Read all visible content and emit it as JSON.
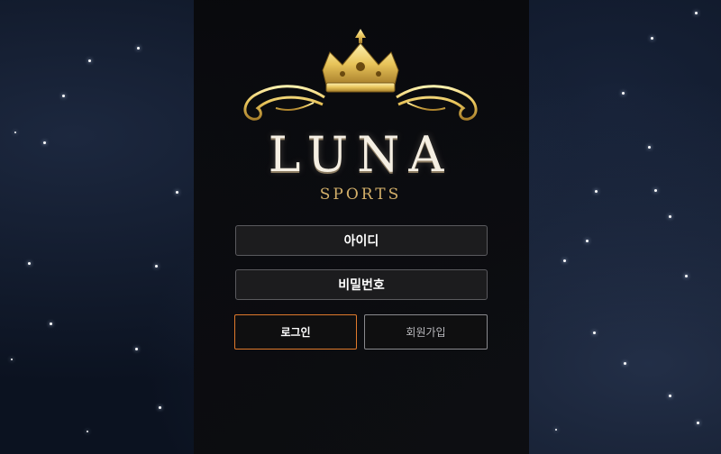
{
  "brand": {
    "name": "LUNA",
    "tagline": "SPORTS",
    "logo_icon": "crown-icon",
    "colors": {
      "gold": "#d4b06a",
      "accent": "#e07a2c"
    }
  },
  "form": {
    "id_placeholder": "아이디",
    "password_placeholder": "비밀번호",
    "login_label": "로그인",
    "signup_label": "회원가입"
  }
}
